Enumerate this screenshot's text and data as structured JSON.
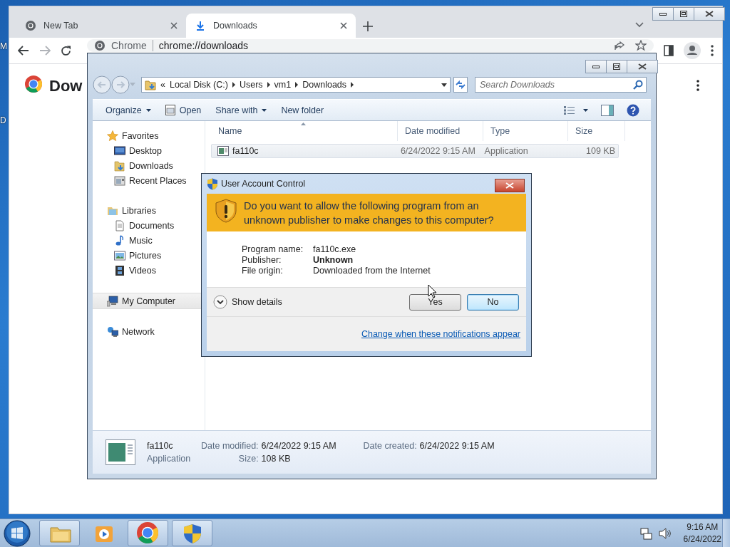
{
  "desktop": {
    "icon_labels": [
      "M",
      "D"
    ]
  },
  "browser": {
    "tabs": [
      {
        "title": "New Tab",
        "selected": false
      },
      {
        "title": "Downloads",
        "selected": true
      }
    ],
    "address": {
      "origin": "Chrome",
      "url": "chrome://downloads"
    },
    "page_heading": "Dow"
  },
  "explorer": {
    "overflow_glyph": "«",
    "breadcrumb": [
      "Local Disk (C:)",
      "Users",
      "vm1",
      "Downloads"
    ],
    "search": {
      "placeholder": "Search Downloads"
    },
    "commands": [
      {
        "label": "Organize",
        "kind": "menu"
      },
      {
        "label": "Open",
        "kind": "open"
      },
      {
        "label": "Share with",
        "kind": "menu"
      },
      {
        "label": "New folder",
        "kind": "plain"
      }
    ],
    "sidebar": [
      {
        "label": "Favorites",
        "selected": false,
        "children": [
          {
            "label": "Desktop",
            "selected": false
          },
          {
            "label": "Downloads",
            "selected": false
          },
          {
            "label": "Recent Places",
            "selected": false
          }
        ]
      },
      {
        "label": "Libraries",
        "selected": false,
        "children": [
          {
            "label": "Documents",
            "selected": false
          },
          {
            "label": "Music",
            "selected": false
          },
          {
            "label": "Pictures",
            "selected": false
          },
          {
            "label": "Videos",
            "selected": false
          }
        ]
      },
      {
        "label": "My Computer",
        "selected": true
      },
      {
        "label": "Network",
        "selected": false
      }
    ],
    "columns": [
      {
        "label": "Name",
        "sorted": true
      },
      {
        "label": "Date modified",
        "sorted": false
      },
      {
        "label": "Type",
        "sorted": false
      },
      {
        "label": "Size",
        "sorted": false
      }
    ],
    "rows": [
      {
        "name": "fa110c",
        "date_modified": "6/24/2022 9:15 AM",
        "type": "Application",
        "size": "109 KB",
        "selected": true
      }
    ],
    "details": {
      "name": "fa110c",
      "type": "Application",
      "fields": [
        {
          "label": "Date modified:",
          "value": "6/24/2022 9:15 AM"
        },
        {
          "label": "Date created:",
          "value": "6/24/2022 9:15 AM"
        },
        {
          "label": "Size:",
          "value": "108 KB"
        }
      ]
    }
  },
  "uac": {
    "title": "User Account Control",
    "question": "Do you want to allow the following program from an unknown publisher to make changes to this computer?",
    "fields": [
      {
        "label": "Program name:",
        "value": "fa110c.exe",
        "bold": false
      },
      {
        "label": "Publisher:",
        "value": "Unknown",
        "bold": true
      },
      {
        "label": "File origin:",
        "value": "Downloaded from the Internet",
        "bold": false
      }
    ],
    "details_toggle": "Show details",
    "buttons": [
      {
        "label": "Yes",
        "default": false
      },
      {
        "label": "No",
        "default": true
      }
    ],
    "link": "Change when these notifications appear"
  },
  "taskbar": {
    "apps": [
      {
        "running": true
      },
      {
        "running": false
      },
      {
        "running": true
      },
      {
        "running": true
      }
    ],
    "time": "9:16 AM",
    "date": "6/24/2022"
  }
}
